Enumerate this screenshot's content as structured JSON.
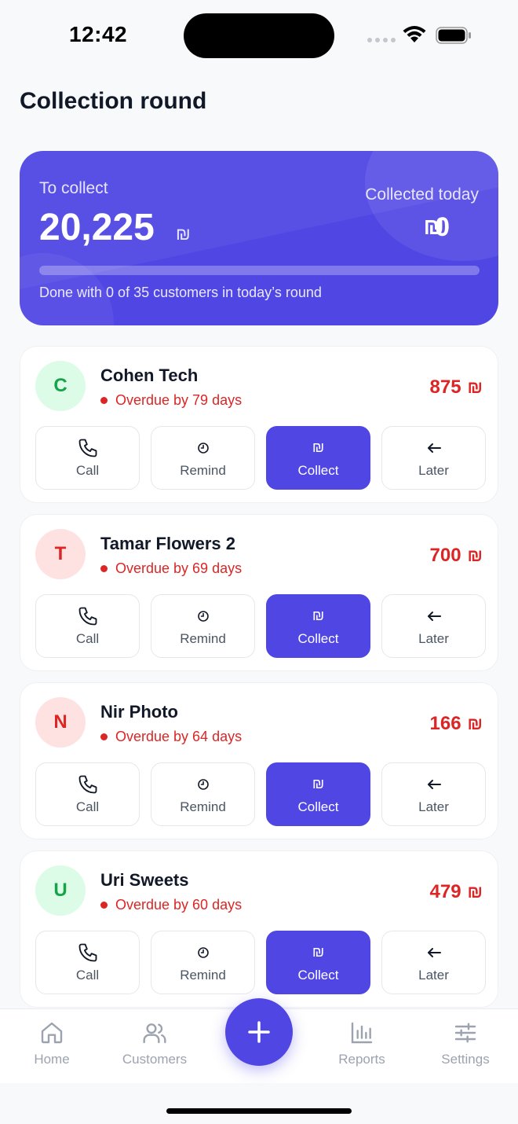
{
  "status_bar": {
    "time": "12:42"
  },
  "page": {
    "title": "Collection round"
  },
  "summary": {
    "to_collect_label": "To collect",
    "to_collect_amount": "20,225",
    "currency_symbol": "₪",
    "collected_today_label": "Collected today",
    "collected_today_amount": "0",
    "progress_fraction": 0,
    "round_status": "Done with 0 of 35 customers in today’s round"
  },
  "colors": {
    "accent": "#5046e4",
    "overdue": "#dc2626",
    "avatar_green": "#16a34a",
    "avatar_red": "#dc2626"
  },
  "actions": {
    "call": "Call",
    "remind": "Remind",
    "collect": "Collect",
    "later": "Later"
  },
  "customers": [
    {
      "initial": "C",
      "name": "Cohen Tech",
      "overdue": "Overdue by 79 days",
      "amount": "875",
      "avatar_color": "green"
    },
    {
      "initial": "T",
      "name": "Tamar Flowers 2",
      "overdue": "Overdue by 69 days",
      "amount": "700",
      "avatar_color": "red"
    },
    {
      "initial": "N",
      "name": "Nir Photo",
      "overdue": "Overdue by 64 days",
      "amount": "166",
      "avatar_color": "red"
    },
    {
      "initial": "U",
      "name": "Uri Sweets",
      "overdue": "Overdue by 60 days",
      "amount": "479",
      "avatar_color": "green"
    }
  ],
  "nav": {
    "home": "Home",
    "customers": "Customers",
    "reports": "Reports",
    "settings": "Settings"
  },
  "icons": {
    "fab": "plus-icon",
    "home": "home-icon",
    "customers": "users-icon",
    "reports": "bar-chart-icon",
    "settings": "sliders-icon"
  }
}
